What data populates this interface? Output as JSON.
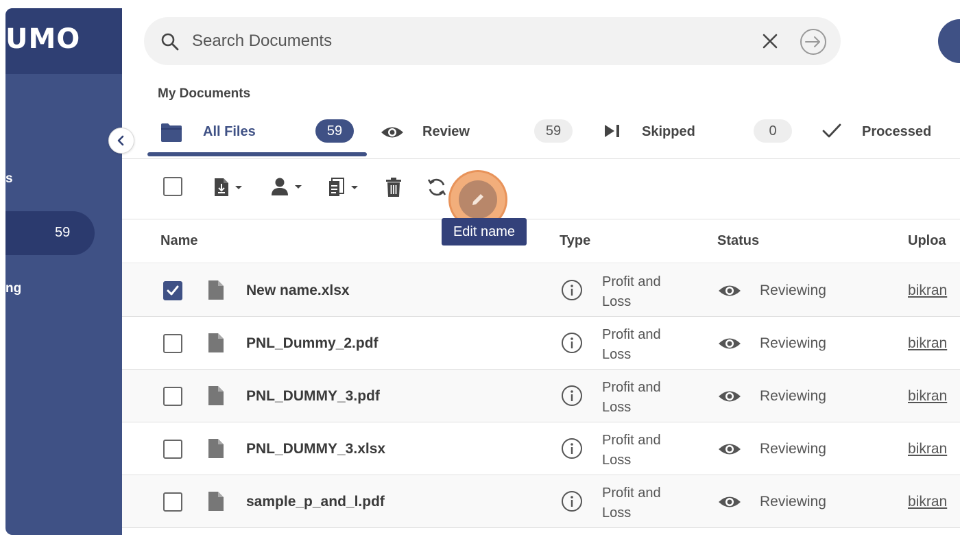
{
  "app": {
    "logo_text": "UMO"
  },
  "sidebar": {
    "items": [
      {
        "label": "s"
      },
      {
        "label": "59"
      },
      {
        "label": "ng"
      }
    ]
  },
  "search": {
    "placeholder": "Search Documents"
  },
  "page": {
    "title": "My Documents"
  },
  "tabs": [
    {
      "label": "All Files",
      "count": "59"
    },
    {
      "label": "Review",
      "count": "59"
    },
    {
      "label": "Skipped",
      "count": "0"
    },
    {
      "label": "Processed"
    }
  ],
  "toolbar": {
    "tooltip": "Edit name"
  },
  "table": {
    "columns": [
      "Name",
      "Type",
      "Status",
      "Uploa"
    ],
    "rows": [
      {
        "name": "New name.xlsx",
        "type": "Profit and Loss",
        "status": "Reviewing",
        "uploader": "bikran",
        "checked": true
      },
      {
        "name": "PNL_Dummy_2.pdf",
        "type": "Profit and Loss",
        "status": "Reviewing",
        "uploader": "bikran",
        "checked": false
      },
      {
        "name": "PNL_DUMMY_3.pdf",
        "type": "Profit and Loss",
        "status": "Reviewing",
        "uploader": "bikran",
        "checked": false
      },
      {
        "name": "PNL_DUMMY_3.xlsx",
        "type": "Profit and Loss",
        "status": "Reviewing",
        "uploader": "bikran",
        "checked": false
      },
      {
        "name": "sample_p_and_l.pdf",
        "type": "Profit and Loss",
        "status": "Reviewing",
        "uploader": "bikran",
        "checked": false
      }
    ]
  },
  "colors": {
    "brand": "#3f5185",
    "brand_dark": "#2f3f73",
    "highlight": "#e8935a"
  },
  "icons": [
    "search-icon",
    "close-icon",
    "enter-icon",
    "chevron-left-icon",
    "folder-icon",
    "eye-icon",
    "skip-icon",
    "check-icon",
    "download-icon",
    "user-icon",
    "document-icon",
    "trash-icon",
    "refresh-icon",
    "pencil-icon",
    "file-icon",
    "info-icon"
  ]
}
